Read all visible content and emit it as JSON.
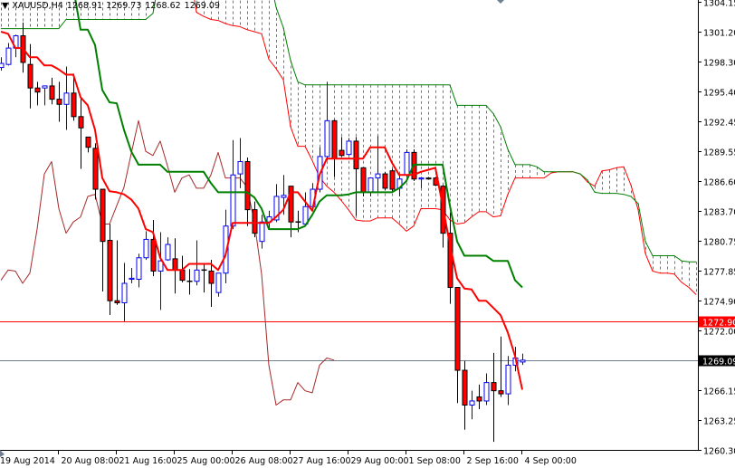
{
  "header": {
    "symbol": "XAUUSD,H4",
    "open": "1268.91",
    "high": "1269.73",
    "low": "1268.62",
    "close": "1269.09"
  },
  "colors": {
    "bull": "#0000ff",
    "bear": "#ff0000",
    "tenkan": "#ff0000",
    "kijun": "#008000",
    "chikou": "#a52a2a",
    "span_a": "#ff0000",
    "span_b": "#008000",
    "cloud_bear_hatch": "#ff4500",
    "cloud_bull_hatch": "#2e8b57",
    "grid_frame": "#000000"
  },
  "chart_data": {
    "type": "candlestick",
    "title": "XAUUSD,H4",
    "ylim": [
      1260.3,
      1304.15
    ],
    "y_ticks": [
      "1304.15",
      "1301.20",
      "1298.30",
      "1295.40",
      "1292.45",
      "1289.55",
      "1286.60",
      "1283.70",
      "1280.75",
      "1277.85",
      "1274.90",
      "1272.00",
      "1269.09",
      "1266.15",
      "1263.25",
      "1260.30"
    ],
    "x_ticks": [
      {
        "index": 0,
        "label": "19 Aug 2014"
      },
      {
        "index": 8,
        "label": "20 Aug 08:00"
      },
      {
        "index": 16,
        "label": "21 Aug 16:00"
      },
      {
        "index": 24,
        "label": "25 Aug 00:00"
      },
      {
        "index": 32,
        "label": "26 Aug 08:00"
      },
      {
        "index": 40,
        "label": "27 Aug 16:00"
      },
      {
        "index": 48,
        "label": "29 Aug 00:00"
      },
      {
        "index": 56,
        "label": "1 Sep 08:00"
      },
      {
        "index": 64,
        "label": "2 Sep 16:00"
      },
      {
        "index": 72,
        "label": "4 Sep 00:00"
      }
    ],
    "hlines": [
      {
        "price": 1272.9,
        "label": "1272.90",
        "line_color": "#ff0000",
        "label_bg": "#ff0000"
      },
      {
        "price": 1269.09,
        "label": "1269.09",
        "line_color": "#708090",
        "label_bg": "#000000"
      }
    ],
    "ohlc": [
      [
        1297.7,
        1298.7,
        1297.4,
        1298.1
      ],
      [
        1298.0,
        1300.1,
        1297.9,
        1299.6
      ],
      [
        1299.6,
        1300.9,
        1298.7,
        1300.8
      ],
      [
        1300.8,
        1302.1,
        1297.2,
        1298.2
      ],
      [
        1298.0,
        1300.0,
        1293.7,
        1295.7
      ],
      [
        1295.7,
        1296.3,
        1294.0,
        1295.3
      ],
      [
        1295.7,
        1295.9,
        1294.0,
        1295.9
      ],
      [
        1295.9,
        1296.7,
        1294.1,
        1294.6
      ],
      [
        1294.6,
        1296.3,
        1292.4,
        1294.1
      ],
      [
        1294.1,
        1297.8,
        1291.6,
        1295.2
      ],
      [
        1295.2,
        1297.1,
        1292.5,
        1292.9
      ],
      [
        1292.9,
        1294.8,
        1287.8,
        1291.8
      ],
      [
        1290.9,
        1290.9,
        1289.4,
        1289.9
      ],
      [
        1289.8,
        1290.3,
        1284.8,
        1285.8
      ],
      [
        1285.8,
        1285.8,
        1275.8,
        1280.7
      ],
      [
        1280.8,
        1282.4,
        1273.5,
        1274.9
      ],
      [
        1274.9,
        1280.8,
        1274.5,
        1274.7
      ],
      [
        1274.7,
        1278.6,
        1272.9,
        1276.6
      ],
      [
        1277.0,
        1278.1,
        1276.6,
        1277.1
      ],
      [
        1277.0,
        1279.5,
        1276.2,
        1279.1
      ],
      [
        1279.1,
        1281.7,
        1278.9,
        1280.9
      ],
      [
        1280.9,
        1282.8,
        1277.3,
        1277.8
      ],
      [
        1277.8,
        1281.6,
        1274.0,
        1278.8
      ],
      [
        1278.9,
        1281.1,
        1278.8,
        1280.4
      ],
      [
        1279.0,
        1281.0,
        1275.6,
        1277.9
      ],
      [
        1277.9,
        1279.3,
        1276.7,
        1276.9
      ],
      [
        1276.8,
        1278.0,
        1275.5,
        1276.8
      ],
      [
        1276.8,
        1280.8,
        1276.4,
        1277.9
      ],
      [
        1277.9,
        1278.5,
        1275.7,
        1277.9
      ],
      [
        1277.8,
        1278.9,
        1274.3,
        1276.6
      ],
      [
        1275.7,
        1277.6,
        1275.3,
        1277.6
      ],
      [
        1277.6,
        1283.8,
        1276.6,
        1282.2
      ],
      [
        1282.2,
        1290.6,
        1281.9,
        1287.2
      ],
      [
        1287.3,
        1290.8,
        1285.9,
        1288.5
      ],
      [
        1288.5,
        1288.9,
        1282.2,
        1283.8
      ],
      [
        1283.8,
        1284.6,
        1281.1,
        1281.5
      ],
      [
        1280.7,
        1283.3,
        1280.0,
        1282.6
      ],
      [
        1282.6,
        1283.7,
        1281.9,
        1283.1
      ],
      [
        1282.8,
        1286.3,
        1282.6,
        1285.1
      ],
      [
        1285.0,
        1287.2,
        1283.3,
        1285.2
      ],
      [
        1286.1,
        1286.1,
        1281.1,
        1282.6
      ],
      [
        1282.6,
        1283.7,
        1281.6,
        1282.6
      ],
      [
        1282.4,
        1285.5,
        1282.2,
        1284.1
      ],
      [
        1284.1,
        1286.4,
        1283.8,
        1285.8
      ],
      [
        1285.8,
        1289.9,
        1285.5,
        1289.0
      ],
      [
        1289.0,
        1296.3,
        1288.6,
        1292.5
      ],
      [
        1292.5,
        1292.6,
        1287.0,
        1288.8
      ],
      [
        1289.6,
        1290.9,
        1289.0,
        1289.1
      ],
      [
        1289.2,
        1290.8,
        1289.1,
        1290.5
      ],
      [
        1290.5,
        1290.9,
        1283.2,
        1287.8
      ],
      [
        1287.9,
        1287.9,
        1285.1,
        1285.5
      ],
      [
        1285.5,
        1286.9,
        1285.1,
        1286.9
      ],
      [
        1286.9,
        1291.0,
        1285.5,
        1287.3
      ],
      [
        1287.3,
        1287.5,
        1285.7,
        1285.9
      ],
      [
        1287.6,
        1287.8,
        1285.5,
        1285.8
      ],
      [
        1285.9,
        1287.2,
        1285.1,
        1286.8
      ],
      [
        1287.2,
        1289.7,
        1287.0,
        1289.4
      ],
      [
        1289.4,
        1289.7,
        1286.6,
        1286.8
      ],
      [
        1286.8,
        1287.0,
        1285.9,
        1286.9
      ],
      [
        1286.9,
        1287.0,
        1286.8,
        1286.8
      ],
      [
        1286.9,
        1287.0,
        1286.1,
        1286.2
      ],
      [
        1286.1,
        1286.2,
        1280.1,
        1281.5
      ],
      [
        1281.5,
        1283.5,
        1274.6,
        1276.2
      ],
      [
        1276.2,
        1276.2,
        1264.9,
        1268.1
      ],
      [
        1268.1,
        1269.0,
        1262.3,
        1264.7
      ],
      [
        1264.7,
        1266.1,
        1263.3,
        1265.1
      ],
      [
        1265.5,
        1266.7,
        1264.3,
        1265.1
      ],
      [
        1265.1,
        1267.8,
        1264.7,
        1266.9
      ],
      [
        1266.9,
        1269.8,
        1261.1,
        1266.1
      ],
      [
        1266.1,
        1271.4,
        1265.5,
        1265.8
      ],
      [
        1265.8,
        1269.5,
        1264.7,
        1268.6
      ],
      [
        1268.6,
        1270.4,
        1268.0,
        1269.3
      ],
      [
        1268.91,
        1269.73,
        1268.62,
        1269.09
      ]
    ],
    "tenkan": [
      1301.2,
      1301.0,
      1299.6,
      1299.6,
      1298.7,
      1298.7,
      1297.9,
      1297.9,
      1297.5,
      1297.0,
      1297.0,
      1294.8,
      1294.0,
      1291.6,
      1286.9,
      1285.6,
      1285.5,
      1285.3,
      1284.8,
      1283.9,
      1281.9,
      1281.6,
      1279.1,
      1277.9,
      1277.9,
      1277.9,
      1278.5,
      1278.5,
      1278.5,
      1278.5,
      1277.9,
      1279.3,
      1282.5,
      1282.5,
      1282.5,
      1282.5,
      1282.5,
      1282.5,
      1283.1,
      1283.8,
      1285.5,
      1285.5,
      1284.6,
      1283.7,
      1287.2,
      1288.8,
      1288.8,
      1288.8,
      1288.8,
      1288.8,
      1288.8,
      1289.9,
      1289.9,
      1289.9,
      1288.4,
      1287.2,
      1287.2,
      1287.2,
      1287.5,
      1287.7,
      1287.9,
      1284.2,
      1280.4,
      1277.1,
      1276.1,
      1276.0,
      1274.9,
      1274.9,
      1274.2,
      1273.5,
      1271.8,
      1269.5,
      1266.2
    ],
    "kijun": [
      1305.5,
      1305.5,
      1305.5,
      1305.5,
      1305.5,
      1305.5,
      1305.5,
      1305.5,
      1305.5,
      1305.5,
      1305.5,
      1301.4,
      1301.4,
      1299.9,
      1295.5,
      1294.3,
      1294.2,
      1291.6,
      1289.5,
      1288.2,
      1288.2,
      1288.2,
      1288.2,
      1287.5,
      1287.5,
      1287.5,
      1287.5,
      1287.5,
      1287.5,
      1286.4,
      1285.5,
      1285.5,
      1285.5,
      1285.5,
      1285.5,
      1285.0,
      1283.9,
      1281.9,
      1281.9,
      1281.9,
      1281.9,
      1281.9,
      1282.2,
      1283.3,
      1284.6,
      1285.2,
      1285.2,
      1285.2,
      1285.3,
      1285.5,
      1285.5,
      1285.5,
      1285.5,
      1285.5,
      1285.5,
      1285.9,
      1286.6,
      1288.2,
      1288.2,
      1288.2,
      1288.2,
      1288.2,
      1284.2,
      1280.7,
      1279.3,
      1279.3,
      1279.3,
      1279.3,
      1278.8,
      1278.8,
      1278.8,
      1276.9,
      1276.2
    ],
    "chikou": [
      1276.9,
      1277.9,
      1277.8,
      1276.6,
      1277.6,
      1281.9,
      1287.3,
      1288.5,
      1283.9,
      1281.5,
      1282.6,
      1283.1,
      1285.1,
      1285.3,
      1282.4,
      1282.4,
      1284.2,
      1286.0,
      1289.3,
      1292.5,
      1289.5,
      1289.1,
      1290.5,
      1288.1,
      1285.5,
      1286.9,
      1287.2,
      1285.9,
      1285.9,
      1287.2,
      1289.4,
      1286.9,
      1286.9,
      1286.9,
      1286.0,
      1282.6,
      1277.5,
      1268.6,
      1264.7,
      1265.2,
      1265.2,
      1266.9,
      1266.1,
      1265.9,
      1268.6,
      1269.3,
      1269.1
    ],
    "senkou_a": [
      1307.8,
      1307.8,
      1307.8,
      1307.8,
      1307.8,
      1307.8,
      1307.8,
      1307.8,
      1307.8,
      1307.8,
      1307.8,
      1307.8,
      1307.8,
      1307.8,
      1307.8,
      1307.8,
      1307.8,
      1307.8,
      1307.8,
      1307.8,
      1307.8,
      1307.8,
      1307.8,
      1307.8,
      1307.8,
      1307.8,
      1307.8,
      1303.1,
      1302.7,
      1302.4,
      1302.3,
      1302.0,
      1301.8,
      1301.7,
      1301.4,
      1301.2,
      1301.0,
      1298.5,
      1297.6,
      1296.5,
      1291.9,
      1290.0,
      1290.0,
      1288.6,
      1287.0,
      1286.1,
      1285.5,
      1284.7,
      1283.8,
      1282.8,
      1282.7,
      1282.7,
      1283.0,
      1283.0,
      1283.0,
      1282.4,
      1281.7,
      1282.2,
      1283.9,
      1283.9,
      1283.9,
      1283.8,
      1282.8,
      1282.4,
      1282.5,
      1283.1,
      1283.6,
      1283.6,
      1283.1,
      1283.2,
      1285.3,
      1286.9,
      1286.9,
      1286.9,
      1286.9,
      1286.9,
      1287.4,
      1287.5,
      1287.5,
      1287.5,
      1287.3,
      1286.5,
      1286.1,
      1287.6,
      1287.7,
      1287.9,
      1288.0,
      1286.2,
      1283.8,
      1279.5,
      1277.8,
      1277.6,
      1277.6,
      1277.5,
      1276.7,
      1276.2,
      1275.5
    ],
    "senkou_b": [
      1301.5,
      1301.5,
      1301.5,
      1301.5,
      1301.5,
      1301.5,
      1301.5,
      1301.5,
      1301.5,
      1302.4,
      1302.4,
      1302.4,
      1302.4,
      1302.4,
      1302.4,
      1302.4,
      1302.4,
      1302.4,
      1302.4,
      1302.4,
      1302.4,
      1303.0,
      1306.9,
      1306.9,
      1306.9,
      1306.9,
      1306.9,
      1306.9,
      1306.9,
      1306.9,
      1306.9,
      1306.9,
      1306.9,
      1306.9,
      1306.9,
      1306.9,
      1306.9,
      1306.9,
      1303.6,
      1301.6,
      1298.4,
      1296.3,
      1296.0,
      1296.0,
      1296.0,
      1296.0,
      1296.0,
      1296.0,
      1296.0,
      1296.0,
      1296.0,
      1296.0,
      1296.0,
      1296.0,
      1296.0,
      1296.0,
      1296.0,
      1296.0,
      1296.0,
      1296.0,
      1296.0,
      1296.0,
      1296.0,
      1294.0,
      1294.0,
      1294.0,
      1294.0,
      1294.0,
      1293.2,
      1291.9,
      1289.7,
      1288.2,
      1288.2,
      1288.2,
      1288.0,
      1287.5,
      1287.5,
      1287.5,
      1287.5,
      1287.5,
      1287.3,
      1286.7,
      1285.5,
      1285.4,
      1285.4,
      1285.4,
      1285.3,
      1285.1,
      1284.4,
      1280.7,
      1279.3,
      1279.3,
      1279.3,
      1279.3,
      1278.8,
      1278.7,
      1278.7
    ]
  }
}
